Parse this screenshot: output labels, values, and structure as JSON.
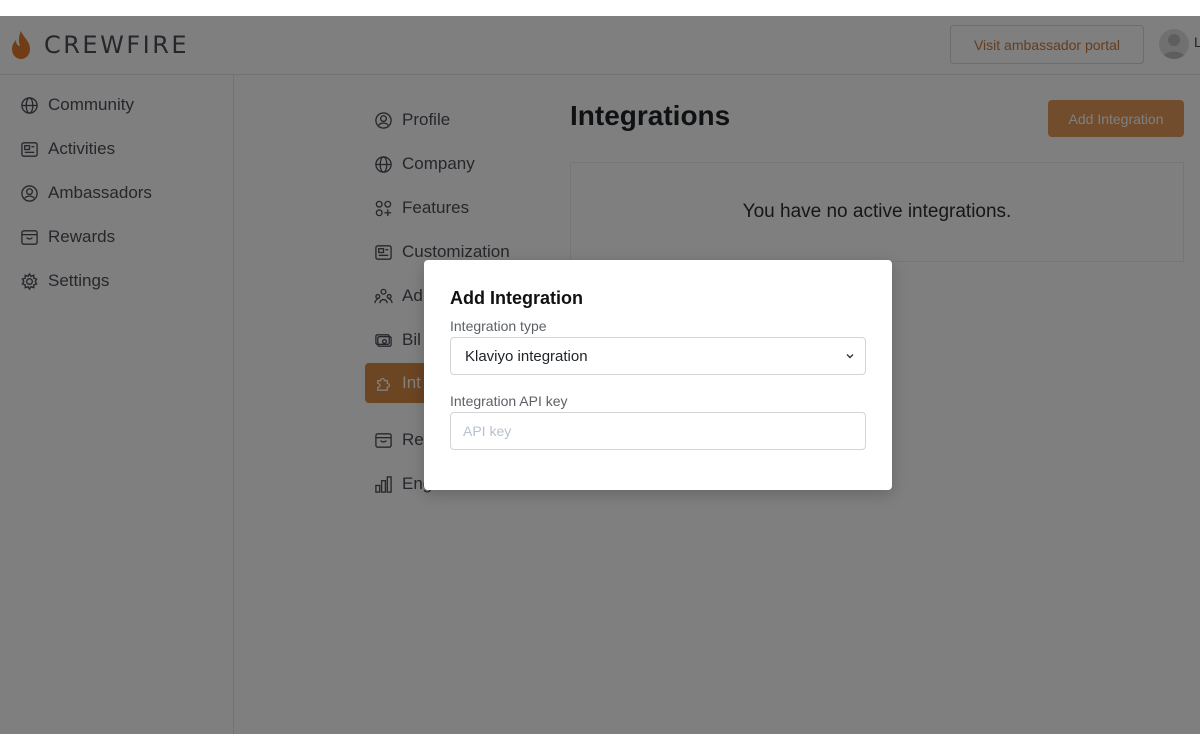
{
  "brand": {
    "name": "CREWFIRE",
    "accent": "#e2995a",
    "flame_color": "#e07a2e"
  },
  "header": {
    "portal_label": "Visit ambassador portal",
    "user_initial": "L"
  },
  "sidebar": {
    "items": [
      {
        "label": "Community",
        "icon": "globe-icon"
      },
      {
        "label": "Activities",
        "icon": "newspaper-icon"
      },
      {
        "label": "Ambassadors",
        "icon": "user-circle-icon"
      },
      {
        "label": "Rewards",
        "icon": "gift-icon"
      },
      {
        "label": "Settings",
        "icon": "gear-icon"
      }
    ]
  },
  "subnav": {
    "items": [
      {
        "label": "Profile",
        "icon": "user-circle-icon"
      },
      {
        "label": "Company",
        "icon": "globe-icon"
      },
      {
        "label": "Features",
        "icon": "features-icon"
      },
      {
        "label": "Customization",
        "icon": "newspaper-icon"
      },
      {
        "label": "Ad",
        "icon": "users-icon"
      },
      {
        "label": "Bil",
        "icon": "billing-icon"
      },
      {
        "label": "Int",
        "icon": "puzzle-icon",
        "active": true
      },
      {
        "label": "Re",
        "icon": "gift-icon"
      },
      {
        "label": "Eng",
        "icon": "bar-chart-icon"
      }
    ]
  },
  "main": {
    "title": "Integrations",
    "add_button": "Add Integration",
    "empty_text": "You have no active integrations."
  },
  "modal": {
    "title": "Add Integration",
    "type_label": "Integration type",
    "type_value": "Klaviyo integration",
    "key_label": "Integration API key",
    "key_placeholder": "API key",
    "key_value": ""
  }
}
